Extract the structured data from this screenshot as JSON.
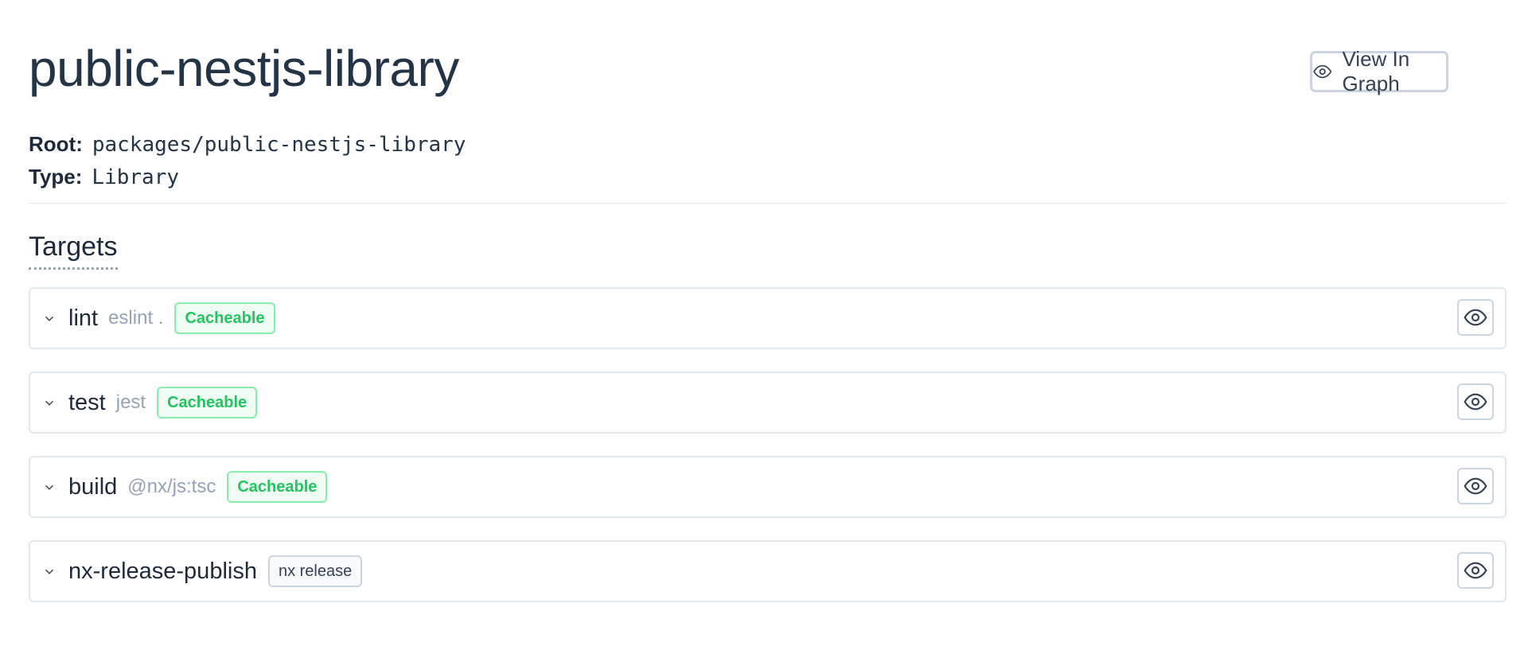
{
  "header": {
    "title": "public-nestjs-library",
    "view_in_graph_label": "View In Graph"
  },
  "meta": {
    "root_label": "Root:",
    "root_value": "packages/public-nestjs-library",
    "type_label": "Type:",
    "type_value": "Library"
  },
  "targets": {
    "heading": "Targets",
    "items": [
      {
        "name": "lint",
        "command": "eslint .",
        "badge": "Cacheable",
        "badge_kind": "cacheable"
      },
      {
        "name": "test",
        "command": "jest",
        "badge": "Cacheable",
        "badge_kind": "cacheable"
      },
      {
        "name": "build",
        "command": "@nx/js:tsc",
        "badge": "Cacheable",
        "badge_kind": "cacheable"
      },
      {
        "name": "nx-release-publish",
        "command": "",
        "badge": "nx release",
        "badge_kind": "neutral"
      }
    ]
  },
  "icons": {
    "view_graph": "eye-icon",
    "expand": "chevron-down-icon",
    "target_view": "eye-icon"
  },
  "colors": {
    "cacheable_text": "#22c55e",
    "cacheable_border": "#86efac",
    "title": "#243447"
  }
}
